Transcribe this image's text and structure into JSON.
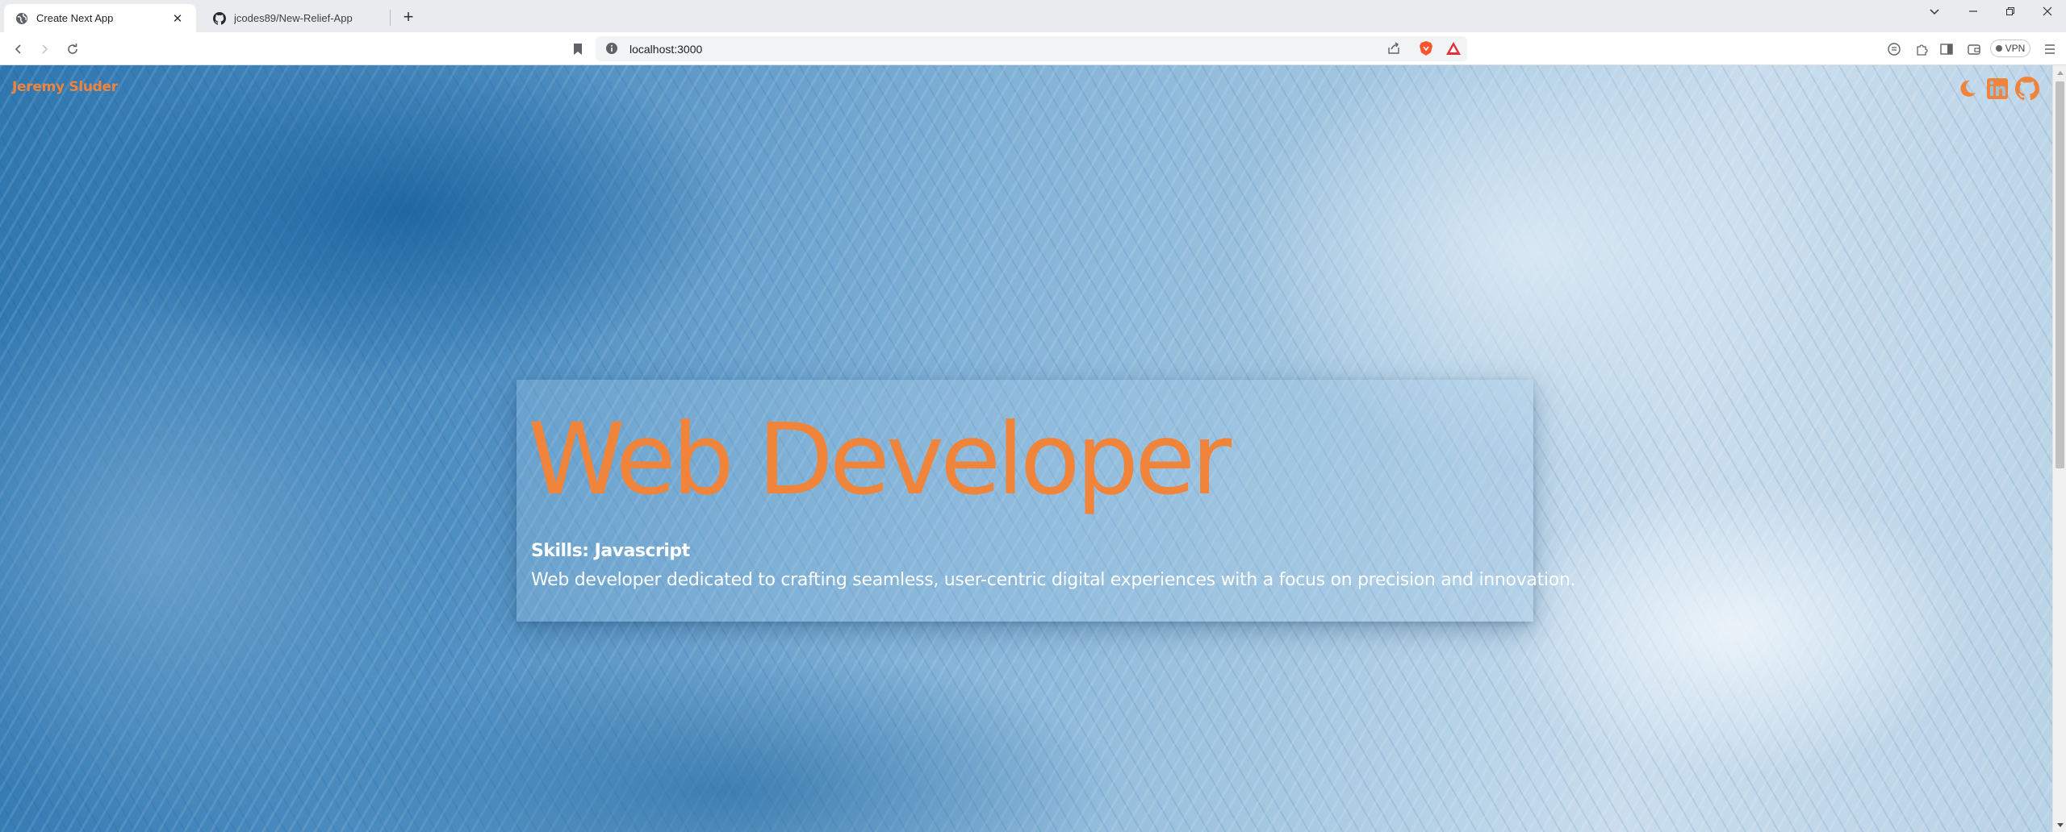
{
  "browser": {
    "tabs": [
      {
        "title": "Create Next App",
        "icon": "globe-icon",
        "active": true
      },
      {
        "title": "jcodes89/New-Relief-App",
        "icon": "github-icon",
        "active": false
      }
    ],
    "new_tab_label": "+",
    "address_bar": {
      "url": "localhost:3000"
    },
    "vpn_label": "VPN"
  },
  "page": {
    "brand": "Jeremy Sluder",
    "header_icons": [
      "moon-icon",
      "linkedin-icon",
      "github-icon"
    ],
    "hero": {
      "title": "Web Developer",
      "skills": "Skills: Javascript",
      "description": "Web developer dedicated to crafting seamless, user-centric digital experiences with a focus on precision and innovation."
    }
  },
  "colors": {
    "accent": "#f0843a",
    "text_light": "#ffffff",
    "brave_orange": "#fb542b",
    "warning_red": "#e0313d"
  }
}
